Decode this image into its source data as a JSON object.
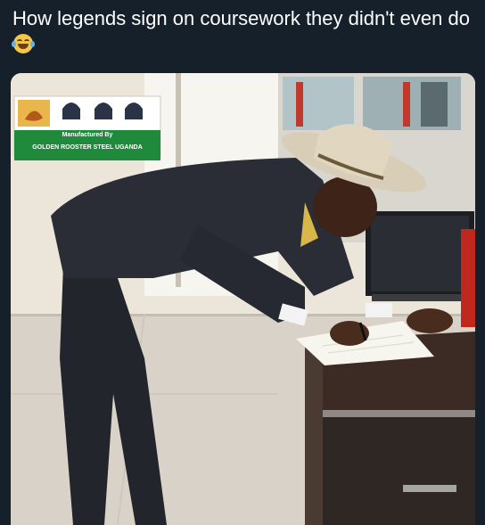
{
  "post": {
    "caption": "How legends sign on coursework they didn't even do",
    "emoji_icon": "face-with-tears-of-joy-icon"
  },
  "photo": {
    "sign": {
      "line1": "Manufactured By",
      "line2": "GOLDEN ROOSTER STEEL UGANDA"
    }
  }
}
